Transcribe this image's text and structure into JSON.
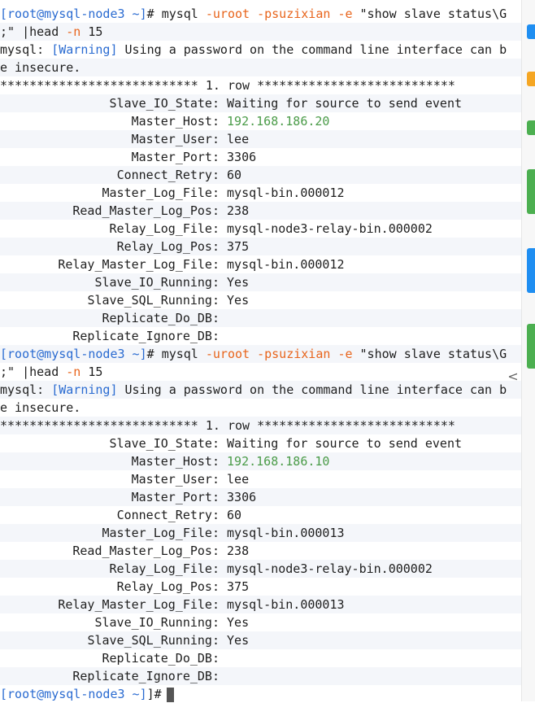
{
  "session1": {
    "prompt_user": "root@mysql-node3 ~",
    "command": "mysql",
    "opt_user": "-uroot",
    "opt_pass": "-psuzixian",
    "opt_exec": "-e",
    "query_part1": "\"show slave status\\G",
    "query_part2": ";\" |head",
    "opt_n": "-n",
    "count": "15",
    "warning_prefix": "mysql: ",
    "warning_tag": "[Warning]",
    "warning_text1": " Using a password on the command line interface can b",
    "warning_text2": "e insecure.",
    "row_header": "*************************** 1. row ***************************",
    "fields": [
      {
        "key": "Slave_IO_State:",
        "value": "Waiting for source to send event"
      },
      {
        "key": "Master_Host:",
        "value": "192.168.186.20",
        "highlight": true
      },
      {
        "key": "Master_User:",
        "value": "lee"
      },
      {
        "key": "Master_Port:",
        "value": "3306"
      },
      {
        "key": "Connect_Retry:",
        "value": "60"
      },
      {
        "key": "Master_Log_File:",
        "value": "mysql-bin.000012"
      },
      {
        "key": "Read_Master_Log_Pos:",
        "value": "238"
      },
      {
        "key": "Relay_Log_File:",
        "value": "mysql-node3-relay-bin.000002"
      },
      {
        "key": "Relay_Log_Pos:",
        "value": "375"
      },
      {
        "key": "Relay_Master_Log_File:",
        "value": "mysql-bin.000012"
      },
      {
        "key": "Slave_IO_Running:",
        "value": "Yes"
      },
      {
        "key": "Slave_SQL_Running:",
        "value": "Yes"
      },
      {
        "key": "Replicate_Do_DB:",
        "value": ""
      },
      {
        "key": "Replicate_Ignore_DB:",
        "value": ""
      }
    ]
  },
  "session2": {
    "prompt_user": "root@mysql-node3 ~",
    "command": "mysql",
    "opt_user": "-uroot",
    "opt_pass": "-psuzixian",
    "opt_exec": "-e",
    "query_part1": "\"show slave status\\G",
    "query_part2": ";\" |head",
    "opt_n": "-n",
    "count": "15",
    "warning_prefix": "mysql: ",
    "warning_tag": "[Warning]",
    "warning_text1": " Using a password on the command line interface can b",
    "warning_text2": "e insecure.",
    "row_header": "*************************** 1. row ***************************",
    "fields": [
      {
        "key": "Slave_IO_State:",
        "value": "Waiting for source to send event"
      },
      {
        "key": "Master_Host:",
        "value": "192.168.186.10",
        "highlight": true
      },
      {
        "key": "Master_User:",
        "value": "lee"
      },
      {
        "key": "Master_Port:",
        "value": "3306"
      },
      {
        "key": "Connect_Retry:",
        "value": "60"
      },
      {
        "key": "Master_Log_File:",
        "value": "mysql-bin.000013"
      },
      {
        "key": "Read_Master_Log_Pos:",
        "value": "238"
      },
      {
        "key": "Relay_Log_File:",
        "value": "mysql-node3-relay-bin.000002"
      },
      {
        "key": "Relay_Log_Pos:",
        "value": "375"
      },
      {
        "key": "Relay_Master_Log_File:",
        "value": "mysql-bin.000013"
      },
      {
        "key": "Slave_IO_Running:",
        "value": "Yes"
      },
      {
        "key": "Slave_SQL_Running:",
        "value": "Yes"
      },
      {
        "key": "Replicate_Do_DB:",
        "value": ""
      },
      {
        "key": "Replicate_Ignore_DB:",
        "value": ""
      }
    ]
  },
  "final_prompt": {
    "prompt_user": "root@mysql-node3 ~",
    "symbol": "]#"
  },
  "sidebar": {
    "collapse_icon": "chevron-left-icon",
    "collapse_glyph": "<",
    "marks": [
      {
        "color": "#1f8ef1",
        "icon": "blue-tab-icon"
      },
      {
        "color": "#f5a623",
        "icon": "orange-tab-icon"
      },
      {
        "color": "#4caf50",
        "icon": "green-tab-icon"
      },
      {
        "color": "#4caf50",
        "icon": "green-tab-icon"
      },
      {
        "color": "#1f8ef1",
        "icon": "blue-tab-icon"
      },
      {
        "color": "#4caf50",
        "icon": "green-tab-icon"
      }
    ]
  },
  "colors": {
    "prompt": "#2a6bd1",
    "option": "#e8641b",
    "host": "#4a9b48"
  }
}
